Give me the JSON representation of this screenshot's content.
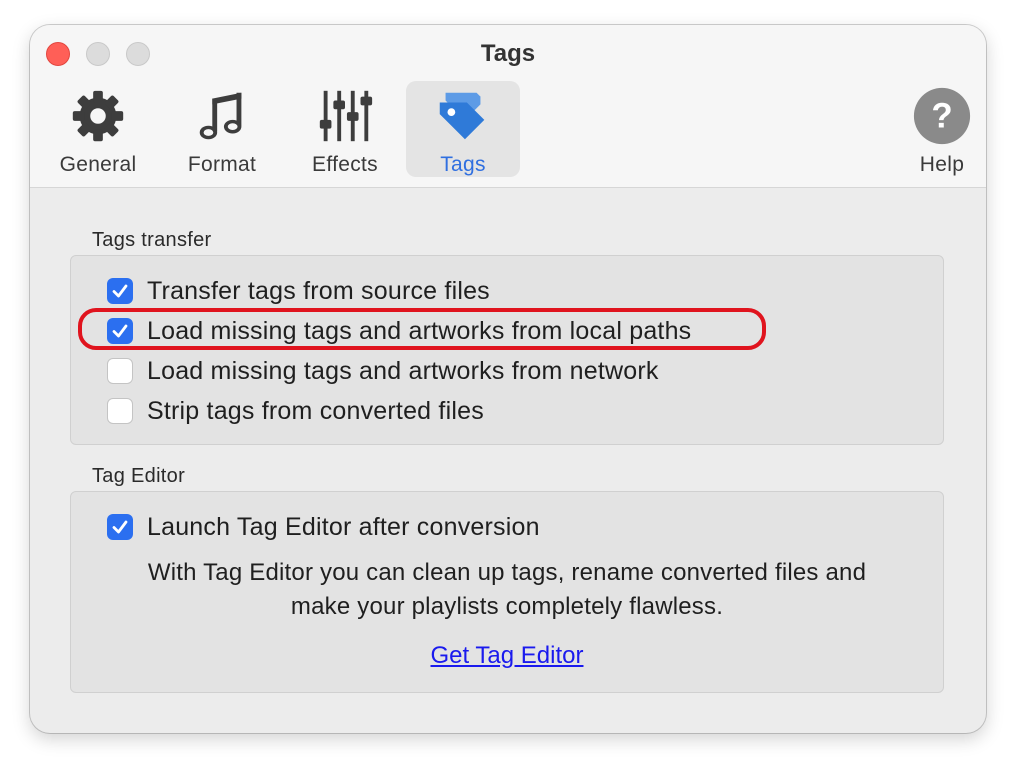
{
  "window": {
    "title": "Tags"
  },
  "toolbar": {
    "items": [
      {
        "label": "General",
        "icon": "gear-icon"
      },
      {
        "label": "Format",
        "icon": "music-note-icon"
      },
      {
        "label": "Effects",
        "icon": "equalizer-sliders-icon"
      },
      {
        "label": "Tags",
        "icon": "tag-icon",
        "selected": true
      },
      {
        "label": "Help",
        "icon": "help-icon"
      }
    ]
  },
  "tags_transfer": {
    "title": "Tags transfer",
    "options": [
      {
        "label": "Transfer tags from source files",
        "checked": true
      },
      {
        "label": "Load missing tags and artworks from local paths",
        "checked": true,
        "highlighted": true
      },
      {
        "label": "Load missing tags and artworks from network",
        "checked": false
      },
      {
        "label": "Strip tags from converted files",
        "checked": false
      }
    ]
  },
  "tag_editor": {
    "title": "Tag Editor",
    "launch_label": "Launch Tag Editor after conversion",
    "launch_checked": true,
    "description_line1": "With Tag Editor you can clean up tags, rename converted files and",
    "description_line2": "make your playlists completely flawless.",
    "link_label": "Get Tag Editor"
  },
  "colors": {
    "accent": "#2b6ff0",
    "highlight_outline": "#e0141e",
    "link": "#1a1aee",
    "close_button": "#ff5f57"
  }
}
